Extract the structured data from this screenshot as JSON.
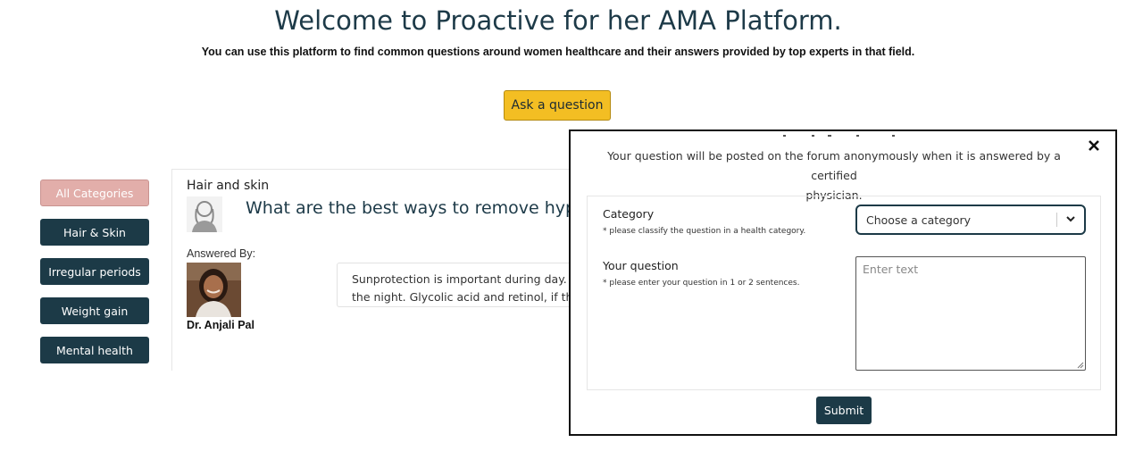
{
  "header": {
    "title": "Welcome to Proactive for her AMA Platform.",
    "subtitle": "You can use this platform to find common questions around women healthcare and their answers provided by top experts in that field.",
    "ask_button": "Ask a question"
  },
  "sidebar": {
    "items": [
      {
        "label": "All Categories",
        "active": true
      },
      {
        "label": "Hair & Skin",
        "active": false
      },
      {
        "label": "Irregular periods",
        "active": false
      },
      {
        "label": "Weight gain",
        "active": false
      },
      {
        "label": "Mental health",
        "active": false
      }
    ]
  },
  "question_card": {
    "category": "Hair and skin",
    "question": "What are the best ways to remove hype",
    "answered_by_label": "Answered By:",
    "doctor_name": "Dr. Anjali Pal",
    "answer_line1": "Sunprotection is important during day. N",
    "answer_line2": "the night. Glycolic acid and retinol, if they"
  },
  "modal": {
    "intro_line1": "Your question will be posted on the forum anonymously when it is answered by a certified",
    "intro_line2": "physician.",
    "category_label": "Category",
    "category_hint": "* please classify the question in a health category.",
    "category_placeholder": "Choose a category",
    "question_label": "Your question",
    "question_hint": "* please enter your question in 1 or 2 sentences.",
    "question_placeholder": "Enter text",
    "submit_label": "Submit",
    "close_icon": "close-icon"
  },
  "colors": {
    "primary": "#1c3a47",
    "accent": "#f3be23",
    "active_category": "#e2aeaa"
  }
}
